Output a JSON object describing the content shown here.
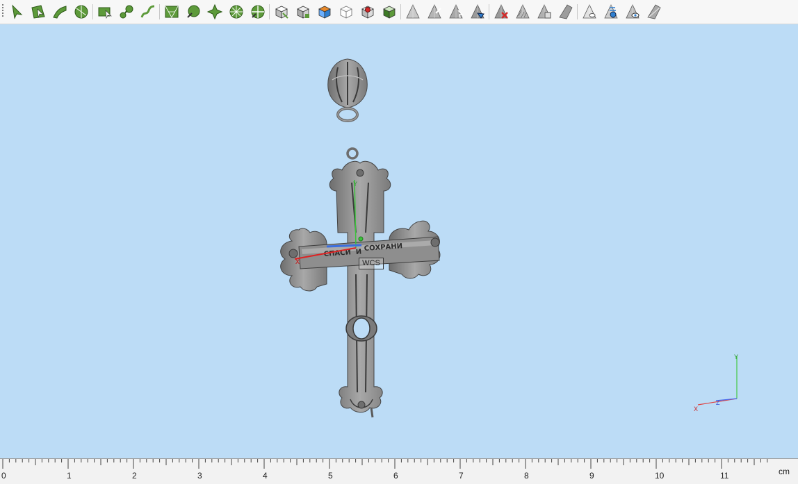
{
  "toolbar": {
    "groups": [
      [
        "curve-select-icon",
        "surface-select-icon",
        "sweep-icon",
        "revolve-icon"
      ],
      [
        "plane-icon",
        "blend-icon",
        "curve-icon"
      ],
      [
        "network-surface-icon",
        "patch-icon",
        "cross-section-icon",
        "radial-icon",
        "split-radial-icon"
      ],
      [
        "box-select-icon",
        "box-mesh-icon",
        "box-color-icon",
        "box-wire-icon",
        "box-gem-icon",
        "box-shade-icon"
      ],
      [
        "cone-icon",
        "cone-extrude-icon",
        "cone-cut-icon",
        "cone-blue-icon"
      ],
      [
        "cone-delete-icon",
        "cone-hatch-icon",
        "cone-copy-icon",
        "cone-solid-icon"
      ],
      [
        "view-icon",
        "view-split-icon",
        "view-eye-icon",
        "view-hide-icon"
      ]
    ],
    "colors": {
      "green": "#5d9a3a",
      "gray": "#8a8a8a",
      "blue": "#2f7fd0",
      "orange": "#e8892a",
      "red": "#d42a2a"
    }
  },
  "viewport": {
    "background": "#bcdcf6",
    "inscription_left": "СПАСИ",
    "inscription_mid": "И",
    "inscription_right": "СОХРАНИ",
    "wcs_label": "WCS",
    "local_axes": {
      "x": "X",
      "y": "Y"
    },
    "corner_axes": {
      "x": "X",
      "y": "Y",
      "z": "Z"
    }
  },
  "ruler": {
    "unit": "cm",
    "labels": [
      "0",
      "1",
      "2",
      "3",
      "4",
      "5",
      "6",
      "7",
      "8",
      "9",
      "10",
      "11"
    ]
  }
}
